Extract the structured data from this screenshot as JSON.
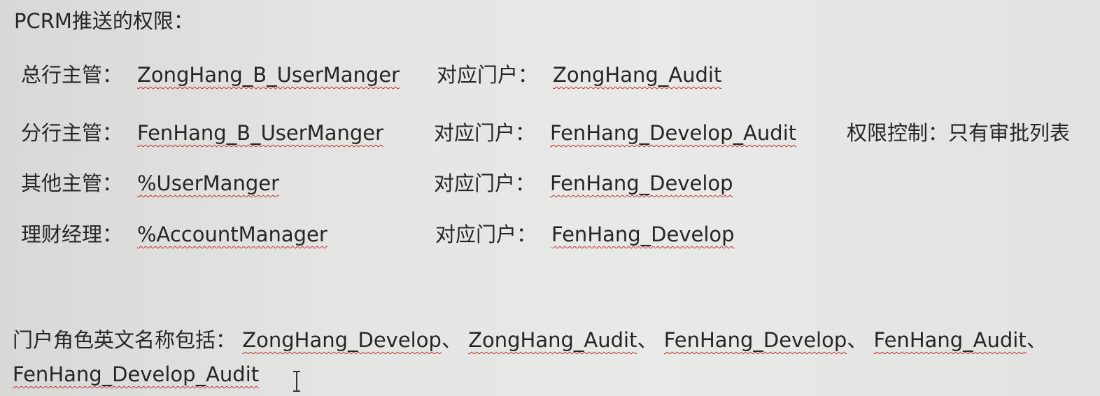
{
  "heading": "PCRM推送的权限：",
  "rows": [
    {
      "label": "总行主管：",
      "value": "ZongHang_B_UserManger",
      "portal_label": "对应门户：",
      "portal_value": "ZongHang_Audit",
      "extra": ""
    },
    {
      "label": "分行主管：",
      "value": "FenHang_B_UserManger",
      "portal_label": "对应门户：",
      "portal_value": "FenHang_Develop_Audit",
      "extra": "权限控制：只有审批列表"
    },
    {
      "label": "其他主管：",
      "value": "%UserManger",
      "portal_label": "对应门户：",
      "portal_value": "FenHang_Develop",
      "extra": ""
    },
    {
      "label": "理财经理：",
      "value": "%AccountManager",
      "portal_label": "对应门户：",
      "portal_value": "FenHang_Develop",
      "extra": ""
    }
  ],
  "footer": {
    "label": "门户角色英文名称包括：",
    "roles": [
      "ZongHang_Develop",
      "ZongHang_Audit",
      "FenHang_Develop",
      "FenHang_Audit",
      "FenHang_Develop_Audit"
    ],
    "separator": "、"
  },
  "icons": {
    "cursor": "text-cursor-icon"
  }
}
